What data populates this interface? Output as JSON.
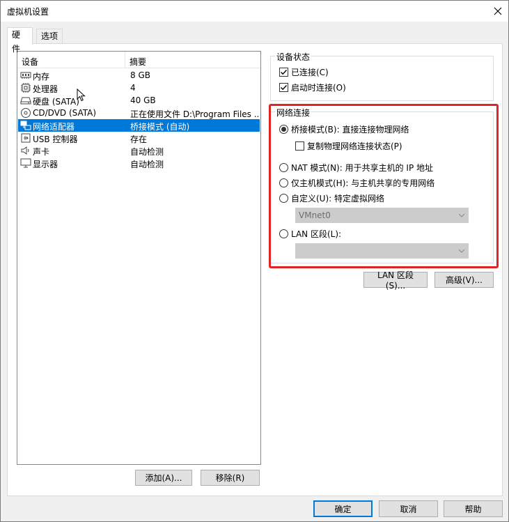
{
  "window": {
    "title": "虚拟机设置"
  },
  "tabs": [
    {
      "label": "硬件",
      "active": true
    },
    {
      "label": "选项",
      "active": false
    }
  ],
  "device_list": {
    "columns": [
      "设备",
      "摘要"
    ],
    "rows": [
      {
        "icon": "memory-icon",
        "device": "内存",
        "summary": "8 GB",
        "selected": false
      },
      {
        "icon": "cpu-icon",
        "device": "处理器",
        "summary": "4",
        "selected": false
      },
      {
        "icon": "hard-disk-icon",
        "device": "硬盘 (SATA)",
        "summary": "40 GB",
        "selected": false
      },
      {
        "icon": "cd-dvd-icon",
        "device": "CD/DVD (SATA)",
        "summary": "正在使用文件 D:\\Program Files ...",
        "selected": false
      },
      {
        "icon": "network-adapter-icon",
        "device": "网络适配器",
        "summary": "桥接模式 (自动)",
        "selected": true
      },
      {
        "icon": "usb-icon",
        "device": "USB 控制器",
        "summary": "存在",
        "selected": false
      },
      {
        "icon": "speaker-icon",
        "device": "声卡",
        "summary": "自动检测",
        "selected": false
      },
      {
        "icon": "monitor-icon",
        "device": "显示器",
        "summary": "自动检测",
        "selected": false
      }
    ]
  },
  "list_buttons": {
    "add": "添加(A)...",
    "remove": "移除(R)"
  },
  "device_status": {
    "title": "设备状态",
    "connected": {
      "label": "已连接(C)",
      "checked": true
    },
    "connect_at_power_on": {
      "label": "启动时连接(O)",
      "checked": true
    }
  },
  "network_connection": {
    "title": "网络连接",
    "bridged": {
      "label": "桥接模式(B): 直接连接物理网络",
      "selected": true
    },
    "replicate": {
      "label": "复制物理网络连接状态(P)",
      "checked": false
    },
    "nat": {
      "label": "NAT 模式(N): 用于共享主机的 IP 地址",
      "selected": false
    },
    "host_only": {
      "label": "仅主机模式(H): 与主机共享的专用网络",
      "selected": false
    },
    "custom": {
      "label": "自定义(U): 特定虚拟网络",
      "selected": false
    },
    "vmnet_value": "VMnet0",
    "lan_segment": {
      "label": "LAN 区段(L):",
      "selected": false
    },
    "lan_value": ""
  },
  "net_buttons": {
    "lan_segments": "LAN 区段(S)...",
    "advanced": "高级(V)..."
  },
  "dialog_buttons": {
    "ok": "确定",
    "cancel": "取消",
    "help": "帮助"
  },
  "colors": {
    "selection": "#0078d7",
    "highlight_border": "#e02424"
  }
}
